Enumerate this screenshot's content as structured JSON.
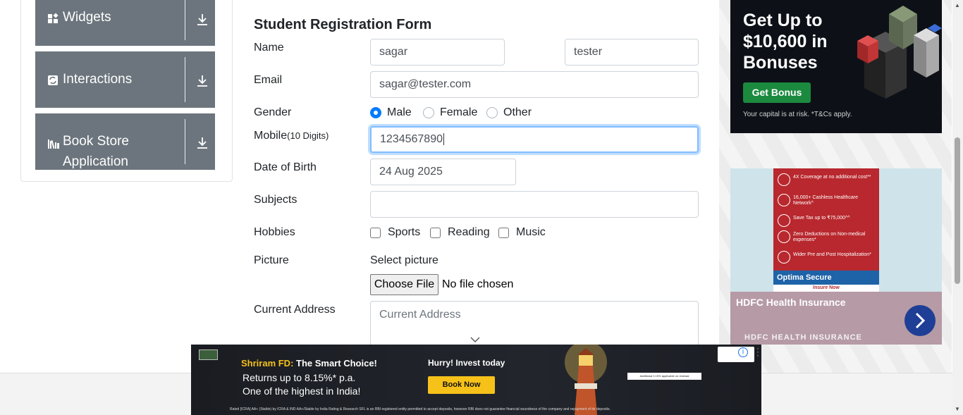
{
  "sidebar": {
    "groups": [
      {
        "label": "Widgets",
        "icon": "widgets-icon"
      },
      {
        "label": "Interactions",
        "icon": "interactions-icon"
      },
      {
        "label": "Book Store",
        "label2": "Application",
        "icon": "book-store-icon"
      }
    ]
  },
  "form": {
    "title": "Student Registration Form",
    "name_label": "Name",
    "first_name": "sagar",
    "last_name": "tester",
    "email_label": "Email",
    "email": "sagar@tester.com",
    "gender_label": "Gender",
    "gender_options": [
      "Male",
      "Female",
      "Other"
    ],
    "gender_selected": "Male",
    "mobile_label": "Mobile",
    "mobile_hint": "(10 Digits)",
    "mobile": "1234567890",
    "dob_label": "Date of Birth",
    "dob": "24 Aug 2025",
    "subjects_label": "Subjects",
    "subjects": "",
    "hobbies_label": "Hobbies",
    "hobbies": [
      "Sports",
      "Reading",
      "Music"
    ],
    "picture_label": "Picture",
    "select_picture": "Select picture",
    "choose_file": "Choose File",
    "no_file": "No file chosen",
    "address_label": "Current Address",
    "address_placeholder": "Current Address"
  },
  "ads": {
    "ad1": {
      "headline": "Get Up to $10,600 in Bonuses",
      "button": "Get Bonus",
      "disclaimer": "Your capital is at risk. *T&Cs apply."
    },
    "ad2": {
      "title": "HDFC Health Insurance",
      "brand": "HDFC HEALTH INSURANCE",
      "features": [
        "4X Coverage at no additional cost**",
        "16,000+ Cashless Healthcare Network^",
        "Save Tax up to ₹75,000^^",
        "Zero Deductions on Non-medical expenses*",
        "Wider Pre and Post Hospitalization*"
      ],
      "product": "Optima Secure",
      "insure": "Insure Now"
    },
    "ad3": {
      "brand_line": "Shriram FD:",
      "brand_line2": "The Smart Choice!",
      "returns": "Returns up to 8.15%* p.a.",
      "highest": "One of the highest in India!",
      "hurry": "Hurry! Invest today",
      "book": "Book Now",
      "note": "Additional 0.15% applicable on renewal",
      "footer": "Rated [ICRA] AA+ (Stable) by ICRA & IND AA+/Stable by India Rating & Research   SFL is an RBI registered entity permitted to accept deposits, however RBI does not guarantee financial soundness of the company and repayment of its deposits."
    }
  },
  "colors": {
    "sidebar_group": "#6c757d",
    "radio_on": "#007bff",
    "focus": "#80bdff"
  }
}
